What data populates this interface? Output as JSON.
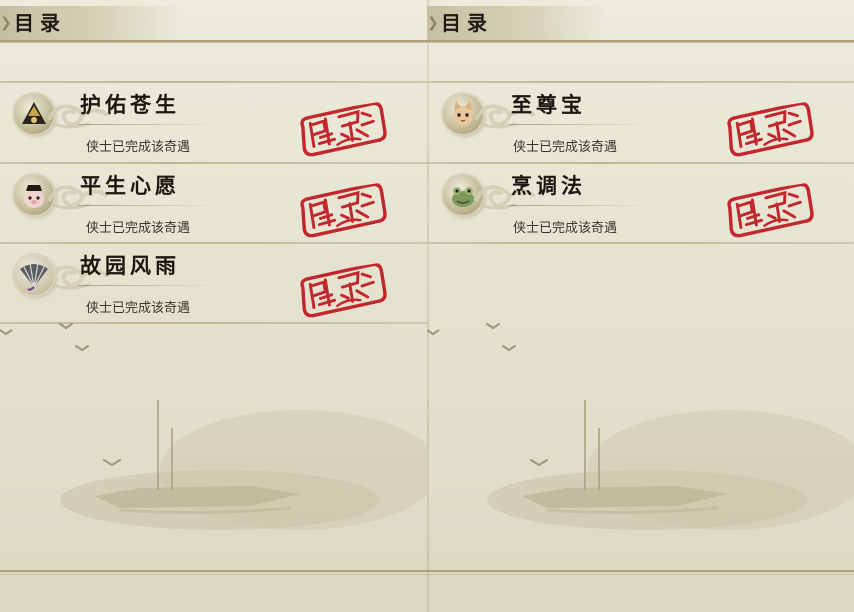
{
  "pages": [
    {
      "header": {
        "title": "目录"
      },
      "entries": [
        {
          "title": "护佑苍生",
          "desc": "侠士已完成该奇遇",
          "icon": "hat-warrior-icon",
          "stamp": "completed-stamp"
        },
        {
          "title": "平生心愿",
          "desc": "侠士已完成该奇遇",
          "icon": "pig-character-icon",
          "stamp": "completed-stamp"
        },
        {
          "title": "故园风雨",
          "desc": "侠士已完成该奇遇",
          "icon": "fan-icon",
          "stamp": "completed-stamp"
        }
      ]
    },
    {
      "header": {
        "title": "目录"
      },
      "entries": [
        {
          "title": "至尊宝",
          "desc": "侠士已完成该奇遇",
          "icon": "cat-pet-icon",
          "stamp": "completed-stamp"
        },
        {
          "title": "烹调法",
          "desc": "侠士已完成该奇遇",
          "icon": "frog-pet-icon",
          "stamp": "completed-stamp"
        }
      ]
    }
  ],
  "colors": {
    "paper": "#e6e4d3",
    "ink": "#1b1710",
    "stamp_red": "#c1272d",
    "rule": "#aaa17c"
  }
}
